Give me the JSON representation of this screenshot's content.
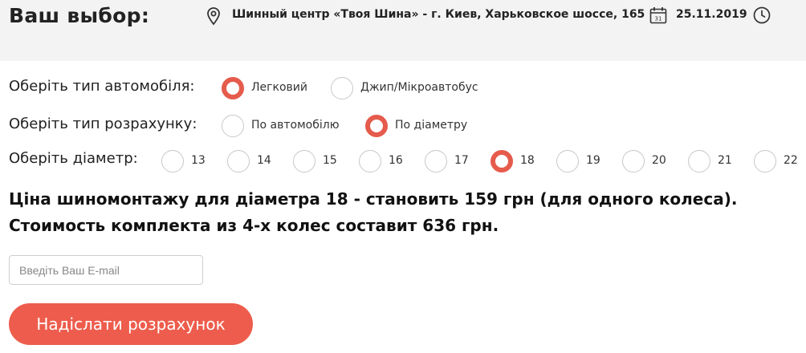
{
  "header": {
    "title": "Ваш выбор:",
    "location_icon": "map-pin-icon",
    "location": "Шинный центр «Твоя Шина» - г. Киев, Харьковское шоссе, 165",
    "calendar_icon": "calendar-icon",
    "calendar_day": "31",
    "date": "25.11.2019",
    "clock_icon": "clock-icon"
  },
  "vehicle": {
    "label": "Оберіть тип автомобіля:",
    "options": [
      {
        "label": "Легковий",
        "checked": true
      },
      {
        "label": "Джип/Мікроавтобус",
        "checked": false
      }
    ]
  },
  "calc": {
    "label": "Оберіть тип розрахунку:",
    "options": [
      {
        "label": "По автомобілю",
        "checked": false
      },
      {
        "label": "По діаметру",
        "checked": true
      }
    ]
  },
  "diameter": {
    "label": "Оберіть діаметр:",
    "options": [
      {
        "label": "13",
        "checked": false
      },
      {
        "label": "14",
        "checked": false
      },
      {
        "label": "15",
        "checked": false
      },
      {
        "label": "16",
        "checked": false
      },
      {
        "label": "17",
        "checked": false
      },
      {
        "label": "18",
        "checked": true
      },
      {
        "label": "19",
        "checked": false
      },
      {
        "label": "20",
        "checked": false
      },
      {
        "label": "21",
        "checked": false
      },
      {
        "label": "22",
        "checked": false
      }
    ]
  },
  "price": {
    "line1": "Ціна шиномонтажу для діаметра 18 - становить 159 грн (для одного колеса).",
    "line2": "Стоимость комплекта из 4-х колес составит 636 грн."
  },
  "form": {
    "email_placeholder": "Введіть Ваш E-mail",
    "email_value": "",
    "submit_label": "Надіслати розрахунок"
  },
  "colors": {
    "accent": "#ed5c4c",
    "header_bg": "#f3f3f3"
  }
}
